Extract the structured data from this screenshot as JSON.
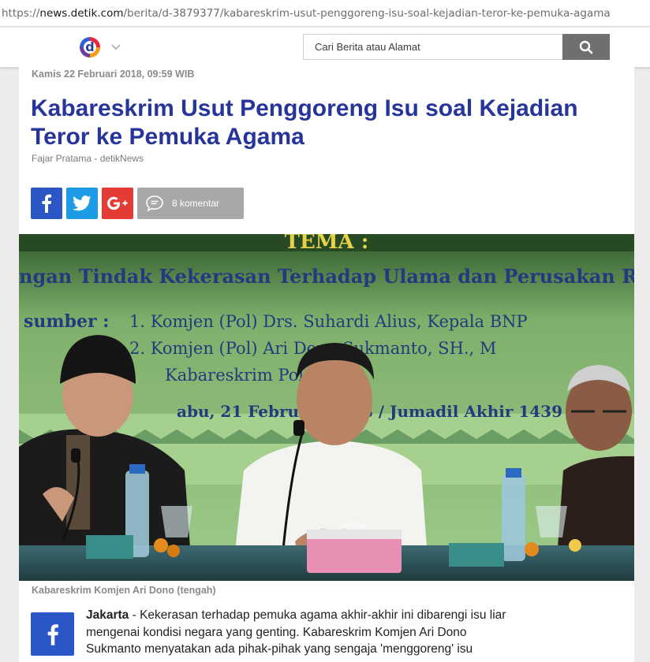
{
  "browser": {
    "url_scheme": "https://",
    "url_host": "news.detik.com",
    "url_path": "/berita/d-3879377/kabareskrim-usut-penggoreng-isu-soal-kejadian-teror-ke-pemuka-agama"
  },
  "header": {
    "logo_letter": "d",
    "search_placeholder": "Cari Berita atau Alamat"
  },
  "article": {
    "date": "Kamis 22 Februari 2018, 09:59 WIB",
    "title": "Kabareskrim Usut Penggoreng Isu soal Kejadian Teror ke Pemuka Agama",
    "author": "Fajar Pratama - detikNews",
    "share": {
      "comments_label": "8 komentar"
    },
    "photo": {
      "banner_heading": "TEMA :",
      "banner_line1": "ngan Tindak Kekerasan Terhadap Ulama dan Perusakan R",
      "banner_line2_label": "sumber :",
      "banner_line2": "1.   Komjen (Pol) Drs. Suhardi Alius, Kepala BNP",
      "banner_line3": "2.   Komjen (Pol) Ari Dono Sukmanto, SH., M",
      "banner_line4": "Kabareskrim Polri",
      "banner_line5": "abu, 21 Februari 2018 / Jumadil Akhir 1439 H",
      "caption": "Kabareskrim Komjen Ari Dono (tengah)"
    },
    "lead_city": "Jakarta",
    "lead_text": " - Kekerasan terhadap pemuka agama akhir-akhir ini dibarengi isu liar mengenai kondisi negara yang genting. Kabareskrim Komjen Ari Dono Sukmanto menyatakan ada pihak-pihak yang sengaja 'menggoreng' isu"
  },
  "colors": {
    "title": "#27349a",
    "facebook": "#2a56c6",
    "twitter": "#1e9be6",
    "googleplus": "#e53b35",
    "comments": "#a8a8a8"
  }
}
